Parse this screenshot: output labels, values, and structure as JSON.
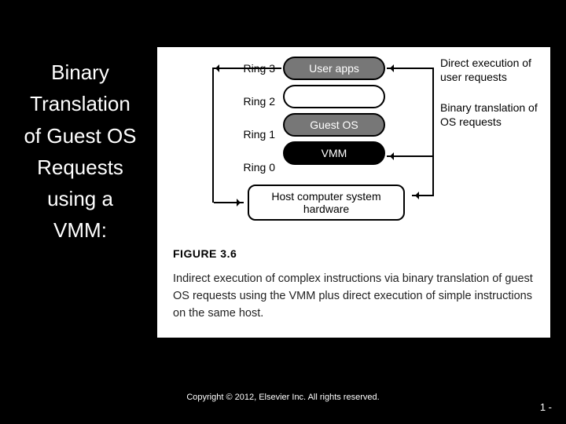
{
  "title_lines": [
    "Binary",
    "Translation",
    "of Guest OS",
    "Requests",
    "using a",
    "VMM:"
  ],
  "rings": {
    "labels": [
      "Ring 3",
      "Ring 2",
      "Ring 1",
      "Ring 0"
    ],
    "boxes": [
      "User apps",
      "",
      "Guest OS",
      "VMM"
    ]
  },
  "host_box": "Host computer system hardware",
  "annotations": {
    "top": "Direct execution of user requests",
    "bottom": "Binary translation of OS requests"
  },
  "figure_label": "FIGURE 3.6",
  "caption": "Indirect execution of complex instructions via binary translation of guest OS requests using the VMM plus direct execution of simple instructions on the same host.",
  "copyright": "Copyright © 2012, Elsevier Inc. All rights reserved.",
  "page_number": "1 -"
}
